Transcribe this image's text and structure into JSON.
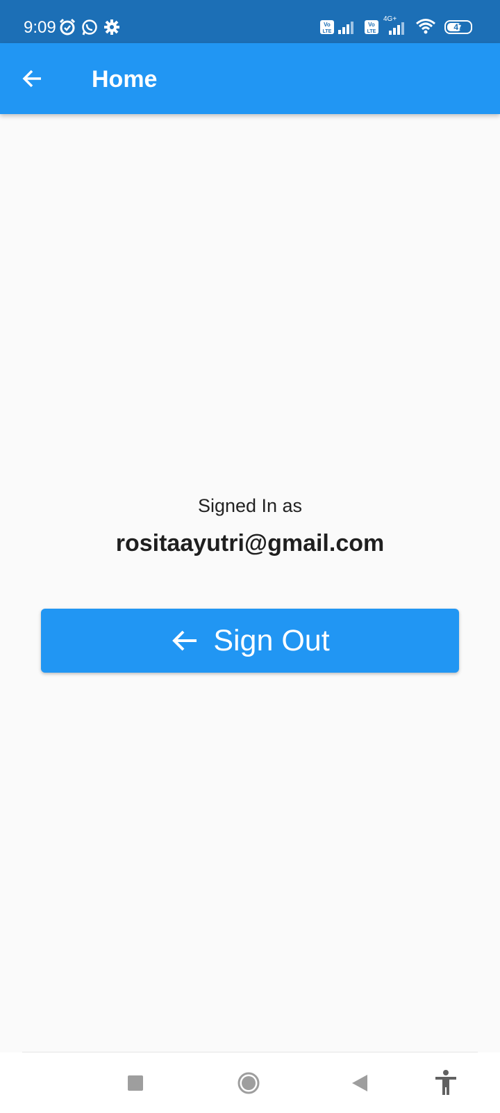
{
  "status_bar": {
    "time": "9:09",
    "icons": [
      "alarm-icon",
      "whatsapp-icon",
      "settings-icon",
      "volte-icon",
      "signal-icon",
      "volte-icon",
      "4g-signal-icon",
      "wifi-icon",
      "battery-icon"
    ],
    "network": "4G+",
    "volte": "Vo LTE",
    "battery": "47"
  },
  "app_bar": {
    "title": "Home",
    "back_icon": "arrow-left-icon"
  },
  "content": {
    "signed_in_label": "Signed In as",
    "email": "rositaayutri@gmail.com",
    "signout_label": "Sign Out",
    "signout_icon": "arrow-left-icon"
  },
  "nav_bar": {
    "icons": [
      "recents-icon",
      "home-icon",
      "back-icon",
      "accessibility-icon"
    ]
  },
  "colors": {
    "status_bar": "#1c6fb6",
    "app_bar": "#2196f3",
    "background": "#fafafa",
    "button": "#2196f3"
  }
}
